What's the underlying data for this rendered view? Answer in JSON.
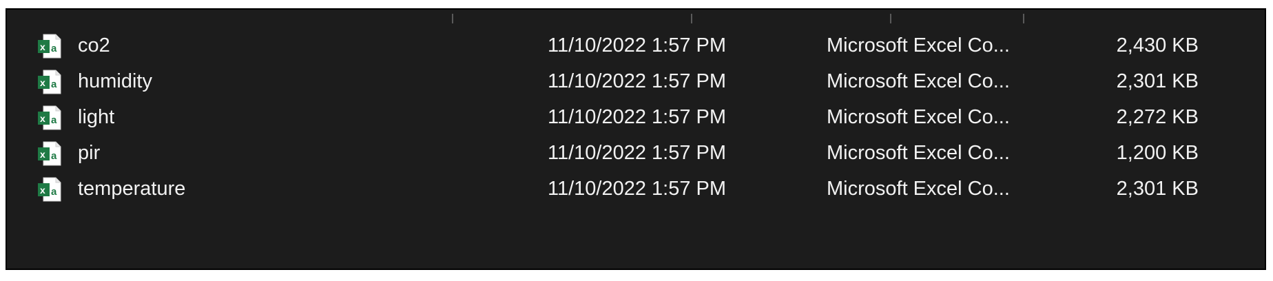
{
  "file_list": {
    "columns": [
      {
        "key": "name"
      },
      {
        "key": "date_modified"
      },
      {
        "key": "type"
      },
      {
        "key": "size"
      }
    ],
    "rows": [
      {
        "name": "co2",
        "date_modified": "11/10/2022 1:57 PM",
        "type": "Microsoft Excel Co...",
        "size": "2,430 KB",
        "icon": "excel-csv-file-icon"
      },
      {
        "name": "humidity",
        "date_modified": "11/10/2022 1:57 PM",
        "type": "Microsoft Excel Co...",
        "size": "2,301 KB",
        "icon": "excel-csv-file-icon"
      },
      {
        "name": "light",
        "date_modified": "11/10/2022 1:57 PM",
        "type": "Microsoft Excel Co...",
        "size": "2,272 KB",
        "icon": "excel-csv-file-icon"
      },
      {
        "name": "pir",
        "date_modified": "11/10/2022 1:57 PM",
        "type": "Microsoft Excel Co...",
        "size": "1,200 KB",
        "icon": "excel-csv-file-icon"
      },
      {
        "name": "temperature",
        "date_modified": "11/10/2022 1:57 PM",
        "type": "Microsoft Excel Co...",
        "size": "2,301 KB",
        "icon": "excel-csv-file-icon"
      }
    ]
  },
  "theme": {
    "background": "#1c1c1c",
    "text": "#f2f2f2",
    "excel_green": "#1f7a45"
  }
}
